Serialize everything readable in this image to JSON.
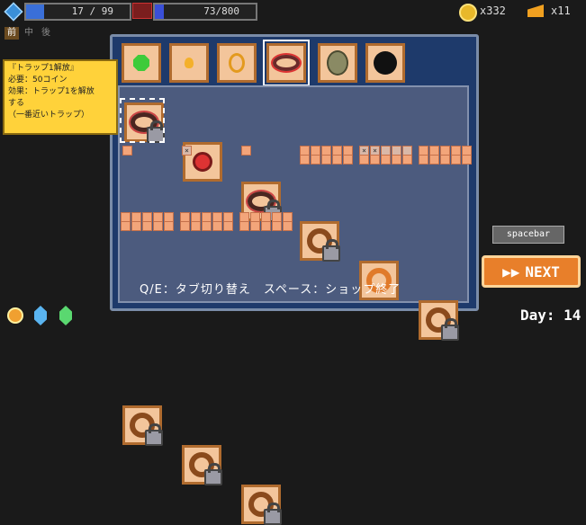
{
  "hud": {
    "hp_text": "17 / 99",
    "hp_fill_ratio": 0.17,
    "mp_text": "73/800",
    "mp_fill_ratio": 0.09,
    "tabs": [
      "前",
      "中",
      "後"
    ],
    "active_tab": 0,
    "coins": "x332",
    "cheese": "x11",
    "colors": {
      "hp": "#3a6fd8",
      "mp": "#3a4fd8",
      "coin": "#e8b82a"
    }
  },
  "shop": {
    "category_tabs": [
      {
        "icon": "green-gem-icon"
      },
      {
        "icon": "fire-icon"
      },
      {
        "icon": "gold-ring-icon"
      },
      {
        "icon": "spiked-ring-icon",
        "active": true
      },
      {
        "icon": "stone-egg-icon"
      },
      {
        "icon": "bomb-icon"
      }
    ],
    "items_row1": [
      {
        "icon": "spiked-trap-icon",
        "locked": true,
        "selected": true,
        "cells": [
          "",
          ""
        ],
        "cells_style": "single"
      },
      {
        "icon": "spiked-trap-check-icon",
        "locked": false,
        "cells": [
          "×"
        ],
        "cells_style": "x"
      },
      {
        "icon": "spiked-trap-icon",
        "locked": true,
        "cells": [
          ""
        ],
        "cells_style": "single"
      },
      {
        "icon": "brown-ring-icon",
        "locked": true,
        "cells": [
          "",
          "",
          "",
          "",
          ""
        ],
        "cells_style": "grid"
      },
      {
        "icon": "orange-ring-icon",
        "locked": false,
        "cells": [
          "×",
          "×",
          "",
          "",
          ""
        ],
        "cells_style": "x"
      },
      {
        "icon": "brown-ring-icon",
        "locked": true,
        "cells": [
          "",
          "",
          "",
          "",
          ""
        ],
        "cells_style": "grid"
      }
    ],
    "items_row2": [
      {
        "icon": "brown-ring-icon",
        "locked": true
      },
      {
        "icon": "brown-ring-icon",
        "locked": true
      },
      {
        "icon": "brown-ring-icon",
        "locked": true
      }
    ],
    "tooltip": {
      "title": "『トラップ1解放』",
      "line1": "必要：50コイン",
      "line2": "効果：トラップ1を解放",
      "line3": "する",
      "line4": "（一番近いトラップ）"
    },
    "help_text": "Q/E：タブ切り替え　スペース：ショップ終了"
  },
  "controls": {
    "spacebar_label": "spacebar",
    "next_label": "NEXT"
  },
  "day": "Day: 14"
}
